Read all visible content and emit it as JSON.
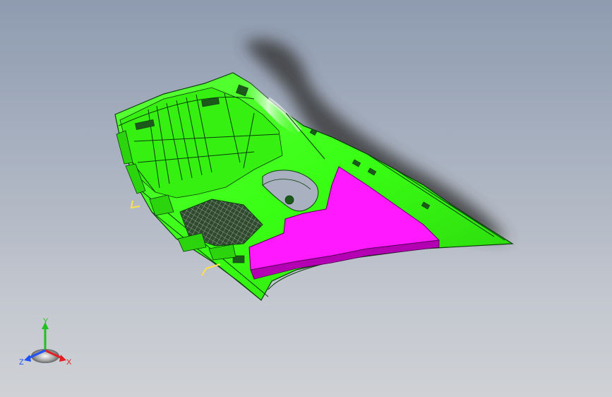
{
  "viewport": {
    "background_top": "#8e9bb0",
    "background_bottom": "#cfd1d5"
  },
  "model": {
    "part_color": "#39ff14",
    "selected_face_color": "#ff19ff",
    "edge_color": "#0b3d0b",
    "shadow_color": "#3a3a3a",
    "annotation_color": "#ffe14d"
  },
  "triad": {
    "x_label": "X",
    "y_label": "Y",
    "z_label": "Z",
    "x_color": "#e02020",
    "y_color": "#20c020",
    "z_color": "#2050ff"
  }
}
